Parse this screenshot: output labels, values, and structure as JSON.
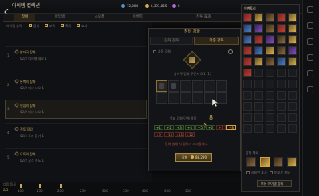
{
  "header": {
    "back_icon": "chevron-left-icon",
    "title": "아이템 컬렉션",
    "currency1": "72,004",
    "currency2": "6,393,865",
    "currency3": "0"
  },
  "tabs": [
    {
      "label": "장비",
      "active": true
    },
    {
      "label": "아임템",
      "active": false
    },
    {
      "label": "소모품",
      "active": false
    },
    {
      "label": "이벤트",
      "active": false
    },
    {
      "label": "전투 효과",
      "active": false
    }
  ],
  "filter": {
    "label": "아이템 능력",
    "options": [
      "장착",
      "보유",
      "획득",
      "효과"
    ]
  },
  "rows": [
    {
      "num": "1",
      "title": "발자국 장화",
      "sub": "02/2 미세해 네오 1",
      "selected": false
    },
    {
      "num": "2",
      "title": "완벽의 장화",
      "sub": "02/2 미세 네오 1",
      "selected": false
    },
    {
      "num": "3",
      "title": "민첩의 장화",
      "sub": "02/2 미세 네오 1",
      "selected": true
    },
    {
      "num": "4",
      "title": "전투 장갑",
      "sub": "02/2 투지 참가 1",
      "selected": false
    },
    {
      "num": "5",
      "title": "도둑의 장화",
      "sub": "02/2 공격 속도 1",
      "selected": false
    }
  ],
  "scale": {
    "left_label": "다음 등급",
    "left_value": "2/3",
    "marks": [
      "100",
      "150",
      "200",
      "250",
      "300",
      "350",
      "400",
      "450",
      "500"
    ]
  },
  "modal": {
    "title": "장비 강화",
    "tab_normal": "강화 강화",
    "tab_multi": "다중 강화",
    "option_label": "자동 강화",
    "item_caption": "방어구 강화 주문서 0/1 (1)",
    "target_label": "목표 강화 단계 설정",
    "target_value": "8",
    "levels_row1": [
      "+1",
      "+2",
      "+3",
      "+4",
      "+5",
      "+6",
      "+7",
      "+8"
    ],
    "levels_row2": [
      "+9",
      "+10",
      "+11",
      "+12"
    ],
    "warning": "강화 실패 시 장비가 파괴됩니다.",
    "button_label": "강화",
    "button_cost": "88,290",
    "close_icon": "close-icon",
    "gear_icon": "gear-icon"
  },
  "inventory": {
    "title": "인벤토리",
    "section_label": "강화 재료",
    "filter1": "장비만 표시",
    "filter2": "미보유 제외",
    "bottom_button": "보유 아이템 정리",
    "close_icon": "close-icon"
  },
  "colors": {
    "accent_gold": "#c9a55a",
    "selected_orange": "#d9a13a",
    "success_green": "#8fd06a",
    "danger_red": "#e06050"
  }
}
